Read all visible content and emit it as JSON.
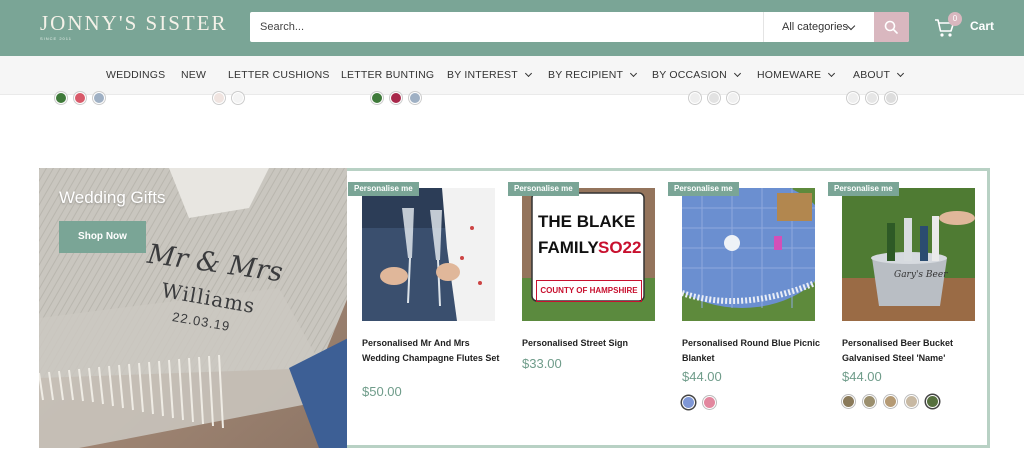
{
  "header": {
    "logo": "JONNY'S SISTER",
    "logo_tagline": "SINCE 2011",
    "search_placeholder": "Search...",
    "category_select": "All categories",
    "cart_count": "0",
    "cart_label": "Cart",
    "brand_color": "#7aa596",
    "accent_color": "#d9b7bf"
  },
  "nav": {
    "items": [
      {
        "label": "WEDDINGS",
        "dropdown": false
      },
      {
        "label": "NEW",
        "dropdown": false
      },
      {
        "label": "LETTER CUSHIONS",
        "dropdown": false
      },
      {
        "label": "LETTER BUNTING",
        "dropdown": false
      },
      {
        "label": "BY INTEREST",
        "dropdown": true
      },
      {
        "label": "BY RECIPIENT",
        "dropdown": true
      },
      {
        "label": "BY OCCASION",
        "dropdown": true
      },
      {
        "label": "HOMEWARE",
        "dropdown": true
      },
      {
        "label": "ABOUT",
        "dropdown": true
      }
    ]
  },
  "banner": {
    "title": "Wedding Gifts",
    "button": "Shop Now",
    "blanket_text": [
      "Mr & Mrs",
      "Williams",
      "22.03.19"
    ]
  },
  "products": [
    {
      "badge": "Personalise me",
      "title": "Personalised Mr And Mrs Wedding Champagne Flutes Set",
      "price": "$50.00",
      "swatches": []
    },
    {
      "badge": "Personalise me",
      "title": "Personalised Street Sign",
      "price": "$33.00",
      "sign_text": [
        "THE BLAKE",
        "FAMILY",
        "SO22",
        "COUNTY OF HAMPSHIRE"
      ],
      "swatches": []
    },
    {
      "badge": "Personalise me",
      "title": "Personalised Round Blue Picnic Blanket",
      "price": "$44.00",
      "swatches": [
        "#7f97d6",
        "#e2879e"
      ]
    },
    {
      "badge": "Personalise me",
      "title": "Personalised Beer Bucket Galvanised Steel 'Name'",
      "price": "$44.00",
      "swatches": [
        "#8a7a5a",
        "#9b8f6e",
        "#b59a74",
        "#c8b9a3",
        "#56703e"
      ]
    }
  ]
}
